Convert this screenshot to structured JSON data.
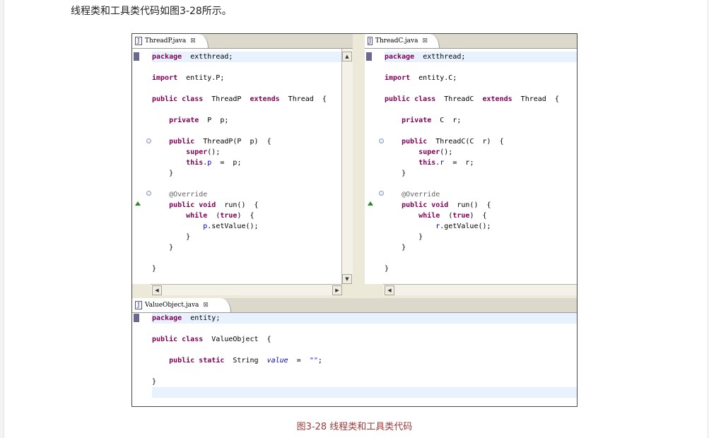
{
  "intro": "线程类和工具类代码如图3-28所示。",
  "caption": "图3-28    线程类和工具类代码",
  "editors": {
    "thread_p": {
      "tab": "ThreadP.java",
      "close": "⊠",
      "lines": [
        [
          [
            "kw",
            "package"
          ],
          [
            "",
            "  extthread;"
          ]
        ],
        [],
        [
          [
            "kw",
            "import"
          ],
          [
            "",
            "  entity.P;"
          ]
        ],
        [],
        [
          [
            "kw",
            "public class"
          ],
          [
            "",
            "  ThreadP  "
          ],
          [
            "kw",
            "extends"
          ],
          [
            "",
            "  Thread  {"
          ]
        ],
        [],
        [
          [
            "",
            "    "
          ],
          [
            "kw",
            "private"
          ],
          [
            "",
            "  P  p;"
          ]
        ],
        [],
        [
          [
            "",
            "    "
          ],
          [
            "kw",
            "public"
          ],
          [
            "",
            "  ThreadP(P  p)  {"
          ]
        ],
        [
          [
            "",
            "        "
          ],
          [
            "kw",
            "super"
          ],
          [
            "",
            "();"
          ]
        ],
        [
          [
            "",
            "        "
          ],
          [
            "kw",
            "this"
          ],
          [
            "",
            "."
          ],
          [
            "fld",
            "p"
          ],
          [
            "",
            "  =  p;"
          ]
        ],
        [
          [
            "",
            "    }"
          ]
        ],
        [],
        [
          [
            "",
            "    "
          ],
          [
            "ann",
            "@Override"
          ]
        ],
        [
          [
            "",
            "    "
          ],
          [
            "kw",
            "public void"
          ],
          [
            "",
            "  run()  {"
          ]
        ],
        [
          [
            "",
            "        "
          ],
          [
            "kw",
            "while"
          ],
          [
            "",
            "  ("
          ],
          [
            "kw",
            "true"
          ],
          [
            "",
            ")  {"
          ]
        ],
        [
          [
            "",
            "            "
          ],
          [
            "fld",
            "p"
          ],
          [
            "",
            ".setValue();"
          ]
        ],
        [
          [
            "",
            "        }"
          ]
        ],
        [
          [
            "",
            "    }"
          ]
        ],
        [],
        [
          [
            "",
            "}"
          ]
        ]
      ]
    },
    "thread_c": {
      "tab": "ThreadC.java",
      "close": "⊠",
      "lines": [
        [
          [
            "kw",
            "package"
          ],
          [
            "",
            "  extthread;"
          ]
        ],
        [],
        [
          [
            "kw",
            "import"
          ],
          [
            "",
            "  entity.C;"
          ]
        ],
        [],
        [
          [
            "kw",
            "public class"
          ],
          [
            "",
            "  ThreadC  "
          ],
          [
            "kw",
            "extends"
          ],
          [
            "",
            "  Thread  {"
          ]
        ],
        [],
        [
          [
            "",
            "    "
          ],
          [
            "kw",
            "private"
          ],
          [
            "",
            "  C  r;"
          ]
        ],
        [],
        [
          [
            "",
            "    "
          ],
          [
            "kw",
            "public"
          ],
          [
            "",
            "  ThreadC(C  r)  {"
          ]
        ],
        [
          [
            "",
            "        "
          ],
          [
            "kw",
            "super"
          ],
          [
            "",
            "();"
          ]
        ],
        [
          [
            "",
            "        "
          ],
          [
            "kw",
            "this"
          ],
          [
            "",
            "."
          ],
          [
            "fld",
            "r"
          ],
          [
            "",
            "  =  r;"
          ]
        ],
        [
          [
            "",
            "    }"
          ]
        ],
        [],
        [
          [
            "",
            "    "
          ],
          [
            "ann",
            "@Override"
          ]
        ],
        [
          [
            "",
            "    "
          ],
          [
            "kw",
            "public void"
          ],
          [
            "",
            "  run()  {"
          ]
        ],
        [
          [
            "",
            "        "
          ],
          [
            "kw",
            "while"
          ],
          [
            "",
            "  ("
          ],
          [
            "kw",
            "true"
          ],
          [
            "",
            ")  {"
          ]
        ],
        [
          [
            "",
            "            "
          ],
          [
            "fld",
            "r"
          ],
          [
            "",
            ".getValue();"
          ]
        ],
        [
          [
            "",
            "        }"
          ]
        ],
        [
          [
            "",
            "    }"
          ]
        ],
        [],
        [
          [
            "",
            "}"
          ]
        ]
      ]
    },
    "value_object": {
      "tab": "ValueObject.java",
      "close": "⊠",
      "lines": [
        [
          [
            "kw",
            "package"
          ],
          [
            "",
            "  entity;"
          ]
        ],
        [],
        [
          [
            "kw",
            "public class"
          ],
          [
            "",
            "  ValueObject  {"
          ]
        ],
        [],
        [
          [
            "",
            "    "
          ],
          [
            "kw",
            "public static"
          ],
          [
            "",
            "  String  "
          ],
          [
            "fld it",
            "value"
          ],
          [
            "",
            "  =  "
          ],
          [
            "str",
            "\"\""
          ],
          [
            "",
            ";"
          ]
        ],
        [],
        [
          [
            "",
            "}"
          ]
        ],
        []
      ]
    }
  },
  "scroll_arrows": {
    "up": "▲",
    "down": "▼",
    "left": "◀",
    "right": "▶"
  },
  "icons": {
    "file": "J"
  }
}
